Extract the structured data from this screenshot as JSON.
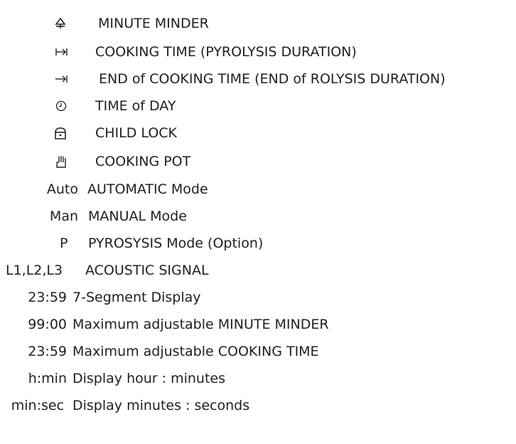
{
  "legend": {
    "icon_rows": [
      {
        "icon": "bell-icon",
        "label": "MINUTE MINDER"
      },
      {
        "icon": "arrow-to-bar-icon",
        "label": "COOKING TIME (PYROLYSIS DURATION)"
      },
      {
        "icon": "arrow-right-bar-icon",
        "label": "END of COOKING TIME (END of ROLYSIS DURATION)"
      },
      {
        "icon": "clock-icon",
        "label": "TIME of DAY"
      },
      {
        "icon": "lock-icon",
        "label": "CHILD LOCK"
      },
      {
        "icon": "hand-icon",
        "label": "COOKING POT"
      }
    ],
    "text_rows": [
      {
        "key": "Auto",
        "label": "AUTOMATIC Mode"
      },
      {
        "key": "Man",
        "label": "MANUAL Mode"
      },
      {
        "key": "P",
        "label": "PYROSYSIS Mode (Option)"
      },
      {
        "key": "L1,L2,L3",
        "label": "ACOUSTIC SIGNAL"
      },
      {
        "key": "23:59",
        "label": "7-Segment Display"
      },
      {
        "key": "99:00",
        "label": "Maximum adjustable MINUTE MINDER"
      },
      {
        "key": "23:59",
        "label": "Maximum adjustable COOKING TIME"
      },
      {
        "key": "h:min",
        "label": "Display hour : minutes"
      },
      {
        "key": "min:sec",
        "label": "Display minutes : seconds"
      }
    ]
  }
}
